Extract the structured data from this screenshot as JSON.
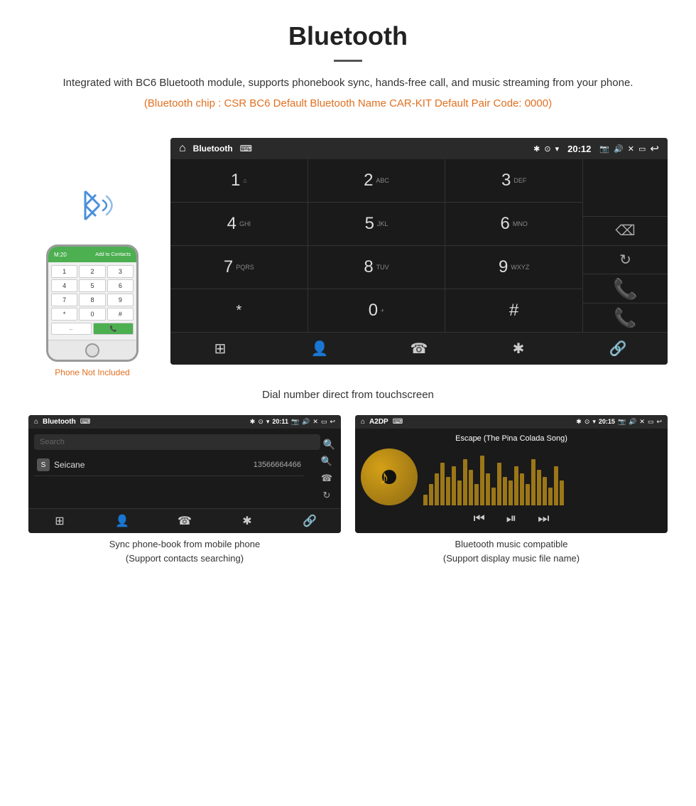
{
  "header": {
    "title": "Bluetooth",
    "description": "Integrated with BC6 Bluetooth module, supports phonebook sync, hands-free call, and music streaming from your phone.",
    "orange_info": "(Bluetooth chip : CSR BC6    Default Bluetooth Name CAR-KIT    Default Pair Code: 0000)"
  },
  "car_screen": {
    "status_bar": {
      "title": "Bluetooth",
      "time": "20:12",
      "usb_symbol": "⌨"
    },
    "dialpad": {
      "keys": [
        {
          "num": "1",
          "sub": "⌂"
        },
        {
          "num": "2",
          "sub": "ABC"
        },
        {
          "num": "3",
          "sub": "DEF"
        },
        {
          "num": "4",
          "sub": "GHI"
        },
        {
          "num": "5",
          "sub": "JKL"
        },
        {
          "num": "6",
          "sub": "MNO"
        },
        {
          "num": "7",
          "sub": "PQRS"
        },
        {
          "num": "8",
          "sub": "TUV"
        },
        {
          "num": "9",
          "sub": "WXYZ"
        },
        {
          "num": "*",
          "sub": ""
        },
        {
          "num": "0",
          "sub": "+"
        },
        {
          "num": "#",
          "sub": ""
        }
      ]
    },
    "caption": "Dial number direct from touchscreen"
  },
  "phone_side": {
    "not_included_text": "Phone Not Included",
    "phone_top_text": "M:20",
    "phone_contact_label": "Add to Contacts",
    "keypad_keys": [
      "1",
      "2",
      "3",
      "4",
      "5",
      "6",
      "7",
      "8",
      "9",
      "*",
      "0",
      "#"
    ]
  },
  "phonebook_screen": {
    "status_bar_title": "Bluetooth",
    "time": "20:11",
    "search_placeholder": "Search",
    "contact_letter": "S",
    "contact_name": "Seicane",
    "contact_number": "13566664466",
    "caption_line1": "Sync phone-book from mobile phone",
    "caption_line2": "(Support contacts searching)"
  },
  "music_screen": {
    "status_bar_title": "A2DP",
    "time": "20:15",
    "song_title": "Escape (The Pina Colada Song)",
    "caption_line1": "Bluetooth music compatible",
    "caption_line2": "(Support display music file name)"
  },
  "icons": {
    "home": "⌂",
    "bluetooth": "✱",
    "search": "🔍",
    "phone_call": "📞",
    "refresh": "↻",
    "backspace": "⌫",
    "grid": "⊞",
    "person": "👤",
    "handset": "☎",
    "link": "🔗",
    "prev": "⏮",
    "play_pause": "⏯",
    "next": "⏭",
    "camera": "📷",
    "volume": "🔊",
    "battery": "🔋"
  }
}
